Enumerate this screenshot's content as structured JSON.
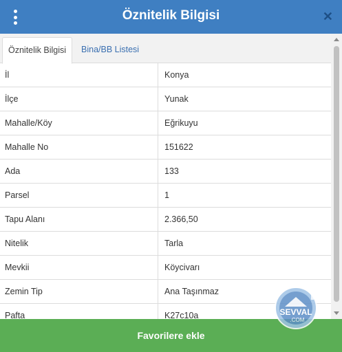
{
  "header": {
    "title": "Öznitelik Bilgisi",
    "close_glyph": "✕"
  },
  "tabs": [
    {
      "label": "Öznitelik Bilgisi",
      "active": true
    },
    {
      "label": "Bina/BB Listesi",
      "active": false
    }
  ],
  "attributes": [
    {
      "key": "İl",
      "value": "Konya"
    },
    {
      "key": "İlçe",
      "value": "Yunak"
    },
    {
      "key": "Mahalle/Köy",
      "value": "Eğrikuyu"
    },
    {
      "key": "Mahalle No",
      "value": "151622"
    },
    {
      "key": "Ada",
      "value": "133"
    },
    {
      "key": "Parsel",
      "value": "1"
    },
    {
      "key": "Tapu Alanı",
      "value": "2.366,50"
    },
    {
      "key": "Nitelik",
      "value": "Tarla"
    },
    {
      "key": "Mevkii",
      "value": "Köycivarı"
    },
    {
      "key": "Zemin Tip",
      "value": "Ana Taşınmaz"
    },
    {
      "key": "Pafta",
      "value": "K27c10a"
    }
  ],
  "footer": {
    "button_label": "Favorilere ekle"
  },
  "watermark": {
    "text": "SEVVAL",
    "subtext": ".COM"
  },
  "colors": {
    "header": "#3f7fc2",
    "footer": "#5bae55",
    "tab_link": "#3a6fb0"
  }
}
